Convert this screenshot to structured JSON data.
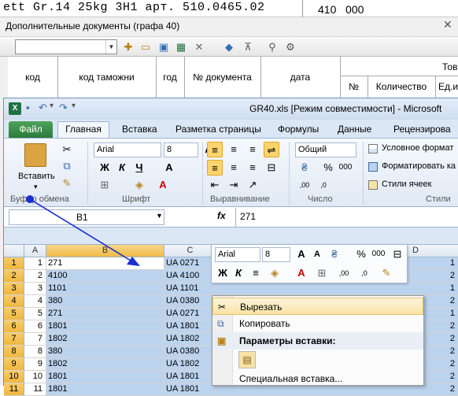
{
  "top_strip": {
    "text": "ett Gr.14 25kg 3H1 арт. 510.0465.02",
    "number_a": "410",
    "number_b": "000"
  },
  "dialog": {
    "title": "Дополнительные документы (графа 40)",
    "close": "✕",
    "columns": [
      "код",
      "код таможни",
      "год",
      "№ документа",
      "дата",
      "№",
      "Количество",
      "Ед.и"
    ],
    "group_header": "Тов"
  },
  "excel": {
    "title": "GR40.xls  [Режим совместимости]  -  Microsoft",
    "tabs": [
      "Файл",
      "Главная",
      "Вставка",
      "Разметка страницы",
      "Формулы",
      "Данные",
      "Рецензирова"
    ],
    "clipboard": {
      "paste": "Вставить",
      "label": "Буфер обмена"
    },
    "font": {
      "name": "Arial",
      "size": "8",
      "label": "Шрифт",
      "bold": "Ж",
      "italic": "К",
      "underline": "Ч"
    },
    "alignment": {
      "label": "Выравнивание"
    },
    "number": {
      "format": "Общий",
      "label": "Число",
      "percent": "%",
      "thousands": "000"
    },
    "styles": {
      "conditional": "Условное формат",
      "format_table": "Форматировать ка",
      "cell_styles": "Стили ячеек",
      "label": "Стили"
    },
    "namebox": "B1",
    "fx": "fx",
    "formula": "271",
    "col_headers": [
      "A",
      "B",
      "C",
      "D"
    ],
    "rows": [
      {
        "n": "1",
        "a": "1",
        "b": "271",
        "c": "UA 0271",
        "e": "1"
      },
      {
        "n": "2",
        "a": "2",
        "b": "4100",
        "c": "UA 4100",
        "e": "2"
      },
      {
        "n": "3",
        "a": "3",
        "b": "1101",
        "c": "UA 1101",
        "e": "1"
      },
      {
        "n": "4",
        "a": "4",
        "b": "380",
        "c": "UA 0380",
        "e": "2"
      },
      {
        "n": "5",
        "a": "5",
        "b": "271",
        "c": "UA 0271",
        "e": "1"
      },
      {
        "n": "6",
        "a": "6",
        "b": "1801",
        "c": "UA 1801",
        "e": "2"
      },
      {
        "n": "7",
        "a": "7",
        "b": "1802",
        "c": "UA 1802",
        "e": "2"
      },
      {
        "n": "8",
        "a": "8",
        "b": "380",
        "c": "UA 0380",
        "e": "2"
      },
      {
        "n": "9",
        "a": "9",
        "b": "1802",
        "c": "UA 1802",
        "e": "2"
      },
      {
        "n": "10",
        "a": "10",
        "b": "1801",
        "c": "UA 1801",
        "e": "2"
      },
      {
        "n": "11",
        "a": "11",
        "b": "1801",
        "c": "UA 1801",
        "e": "2"
      }
    ],
    "mini_toolbar": {
      "font": "Arial",
      "size": "8",
      "bold": "Ж",
      "italic": "К",
      "percent": "%",
      "thousands": "000"
    },
    "context_menu": {
      "cut": "Вырезать",
      "copy": "Копировать",
      "paste_options": "Параметры вставки:",
      "paste_special": "Специальная вставка..."
    }
  }
}
